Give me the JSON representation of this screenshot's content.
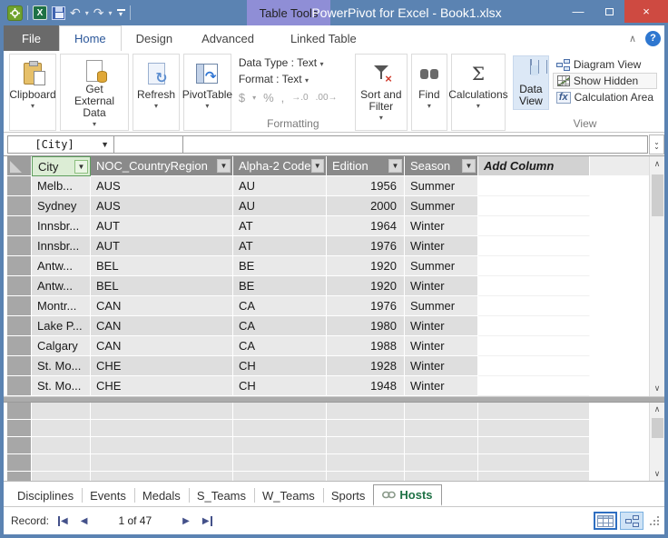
{
  "window": {
    "title": "PowerPivot for Excel - Book1.xlsx",
    "contextual_tab": "Table Tools",
    "controls": {
      "minimize": "minimize",
      "maximize": "maximize",
      "close": "close"
    },
    "title_bar_color": "#5b83b2",
    "close_color": "#ce4a41",
    "contextual_tab_color": "#8f8ed6"
  },
  "qat": {
    "icons": [
      "powerpivot-icon",
      "excel-icon",
      "save-icon",
      "undo-icon",
      "redo-icon",
      "customize-qat-icon"
    ],
    "undo_glyph": "↶",
    "redo_glyph": "↷"
  },
  "tabs": [
    {
      "label": "File",
      "style": "file"
    },
    {
      "label": "Home",
      "style": "active"
    },
    {
      "label": "Design",
      "style": ""
    },
    {
      "label": "Advanced",
      "style": ""
    },
    {
      "label": "Linked Table",
      "style": "linked"
    }
  ],
  "ribbon": {
    "big_buttons": [
      {
        "label": "Clipboard",
        "icon": "clipboard-icon"
      },
      {
        "label": "Get External Data",
        "icon": "get-external-data-icon"
      },
      {
        "label": "Refresh",
        "icon": "refresh-icon"
      },
      {
        "label": "PivotTable",
        "icon": "pivottable-icon"
      }
    ],
    "formatting": {
      "data_type": "Data Type : Text",
      "format": "Format : Text",
      "icons": [
        {
          "name": "currency-icon",
          "glyph": "$"
        },
        {
          "name": "percent-icon",
          "glyph": "%"
        },
        {
          "name": "thousands-separator-icon",
          "glyph": ","
        },
        {
          "name": "increase-decimal-icon",
          "glyph": "→.0"
        },
        {
          "name": "decrease-decimal-icon",
          "glyph": ".00→"
        }
      ],
      "group_label": "Formatting"
    },
    "sort_filter": {
      "label": "Sort and Filter",
      "icon": "sort-filter-icon"
    },
    "find": {
      "label": "Find",
      "icon": "find-icon"
    },
    "calculations": {
      "label": "Calculations",
      "icon": "sigma-icon"
    },
    "view": {
      "data_view": "Data View",
      "diagram_view": "Diagram View",
      "show_hidden": "Show Hidden",
      "calculation_area": "Calculation Area",
      "group_label": "View"
    },
    "collapse_icon": "collapse-ribbon-icon",
    "help_label": "?"
  },
  "formula_bar": {
    "field": "[City]"
  },
  "grid": {
    "columns": [
      {
        "name": "City",
        "selected": true
      },
      {
        "name": "NOC_CountryRegion"
      },
      {
        "name": "Alpha-2 Code"
      },
      {
        "name": "Edition",
        "align": "right"
      },
      {
        "name": "Season"
      },
      {
        "name": "Add Column",
        "add": true
      }
    ],
    "rows": [
      [
        "Melb...",
        "AUS",
        "AU",
        "1956",
        "Summer"
      ],
      [
        "Sydney",
        "AUS",
        "AU",
        "2000",
        "Summer"
      ],
      [
        "Innsbr...",
        "AUT",
        "AT",
        "1964",
        "Winter"
      ],
      [
        "Innsbr...",
        "AUT",
        "AT",
        "1976",
        "Winter"
      ],
      [
        "Antw...",
        "BEL",
        "BE",
        "1920",
        "Summer"
      ],
      [
        "Antw...",
        "BEL",
        "BE",
        "1920",
        "Winter"
      ],
      [
        "Montr...",
        "CAN",
        "CA",
        "1976",
        "Summer"
      ],
      [
        "Lake P...",
        "CAN",
        "CA",
        "1980",
        "Winter"
      ],
      [
        "Calgary",
        "CAN",
        "CA",
        "1988",
        "Winter"
      ],
      [
        "St. Mo...",
        "CHE",
        "CH",
        "1928",
        "Winter"
      ],
      [
        "St. Mo...",
        "CHE",
        "CH",
        "1948",
        "Winter"
      ]
    ],
    "calc_area_rows": 5,
    "selected_header_color": "#dcedd5",
    "header_color": "#8a8a8a"
  },
  "sheet_tabs": {
    "tabs": [
      "Disciplines",
      "Events",
      "Medals",
      "S_Teams",
      "W_Teams",
      "Sports",
      "Hosts"
    ],
    "active": "Hosts",
    "active_color": "#1e7145",
    "active_icon": "linked-table-icon"
  },
  "record_bar": {
    "label": "Record:",
    "position": "1 of 47",
    "nav_icons": [
      "first-record-icon",
      "previous-record-icon",
      "next-record-icon",
      "last-record-icon"
    ]
  },
  "status_views": [
    "grid-view-button",
    "diagram-view-button"
  ]
}
